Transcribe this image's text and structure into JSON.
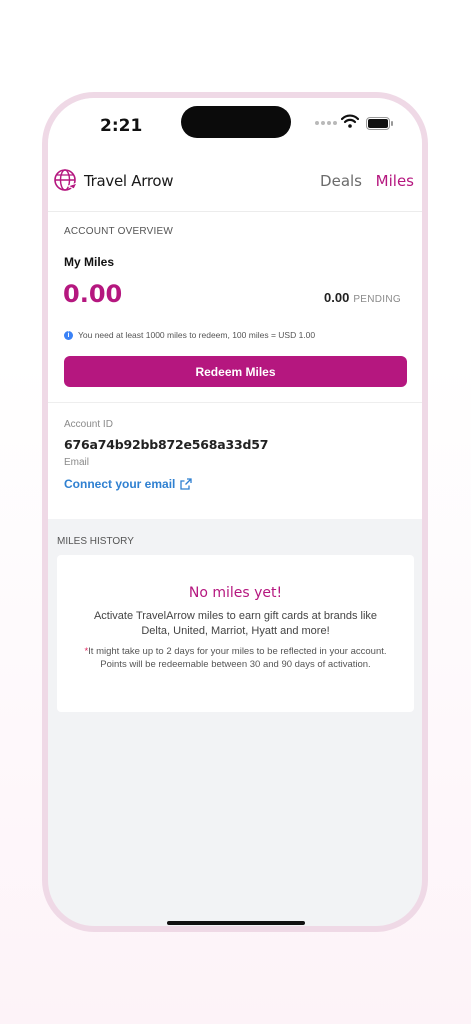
{
  "status_bar": {
    "time": "2:21"
  },
  "header": {
    "brand": "Travel Arrow",
    "nav": [
      {
        "label": "Deals",
        "active": false
      },
      {
        "label": "Miles",
        "active": true
      }
    ]
  },
  "overview": {
    "section_label": "ACCOUNT OVERVIEW",
    "my_miles_label": "My Miles",
    "miles_value": "0.00",
    "pending_value": "0.00",
    "pending_label": "PENDING",
    "info_text": "You need at least 1000 miles to redeem, 100 miles = USD 1.00",
    "redeem_label": "Redeem Miles"
  },
  "account": {
    "id_label": "Account ID",
    "id_value": "676a74b92bb872e568a33d57",
    "email_label": "Email",
    "connect_email": "Connect your email"
  },
  "history": {
    "section_label": "MILES HISTORY",
    "empty_title": "No miles yet!",
    "empty_desc": "Activate TravelArrow miles to earn gift cards at brands like Delta, United, Marriot, Hyatt and more!",
    "note_star": "*",
    "note": "It might take up to 2 days for your miles to be reflected in your account. Points will be redeemable between 30 and 90 days of activation."
  },
  "colors": {
    "accent": "#b5177f",
    "link": "#2f80d1",
    "info": "#3b82f6"
  }
}
